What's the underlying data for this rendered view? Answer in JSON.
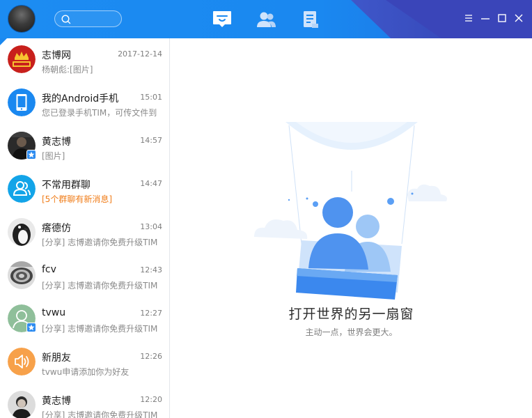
{
  "app": {
    "title": "TIM",
    "accent_color": "#1a88f0"
  },
  "titlebar": {
    "search_placeholder": "",
    "nav": [
      {
        "name": "messages",
        "icon": "chat-bubble-icon",
        "active": true
      },
      {
        "name": "contacts",
        "icon": "contacts-icon",
        "active": false
      },
      {
        "name": "files",
        "icon": "document-icon",
        "active": false
      }
    ],
    "window_buttons": [
      "menu-icon",
      "minimize-icon",
      "maximize-icon",
      "close-icon"
    ]
  },
  "conversations": [
    {
      "name": "志博网",
      "time": "2017-12-14",
      "preview": "杨朝彪:[图片]",
      "avatar": "crown-logo",
      "pinned": true,
      "highlight": false
    },
    {
      "name": "我的Android手机",
      "time": "15:01",
      "preview": "您已登录手机TIM，可传文件到",
      "avatar": "phone-icon",
      "highlight": false
    },
    {
      "name": "黄志博",
      "time": "14:57",
      "preview": "[图片]",
      "avatar": "person-photo",
      "badge": "star",
      "highlight": false
    },
    {
      "name": "不常用群聊",
      "time": "14:47",
      "preview": "[5个群聊有新消息]",
      "avatar": "group-icon",
      "highlight": true
    },
    {
      "name": "瘩德仿",
      "time": "13:04",
      "preview": "[分享] 志博邀请你免费升级TIM",
      "avatar": "penguin-photo",
      "highlight": false
    },
    {
      "name": "fcv",
      "time": "12:43",
      "preview": "[分享] 志博邀请你免费升级TIM",
      "avatar": "spiral-photo",
      "highlight": false
    },
    {
      "name": "tvwu",
      "time": "12:27",
      "preview": "[分享] 志博邀请你免费升级TIM",
      "avatar": "default-person",
      "badge": "star",
      "highlight": false
    },
    {
      "name": "新朋友",
      "time": "12:26",
      "preview": "tvwu申请添加你为好友",
      "avatar": "speaker-icon",
      "highlight": false
    },
    {
      "name": "黄志博",
      "time": "12:20",
      "preview": "[分享] 志博邀请你免费升级TIM",
      "avatar": "person-photo-2",
      "highlight": false
    }
  ],
  "main": {
    "empty_title": "打开世界的另一扇窗",
    "empty_subtitle": "主动一点，世界会更大。",
    "illustration": "hot-air-balloon-illustration"
  }
}
